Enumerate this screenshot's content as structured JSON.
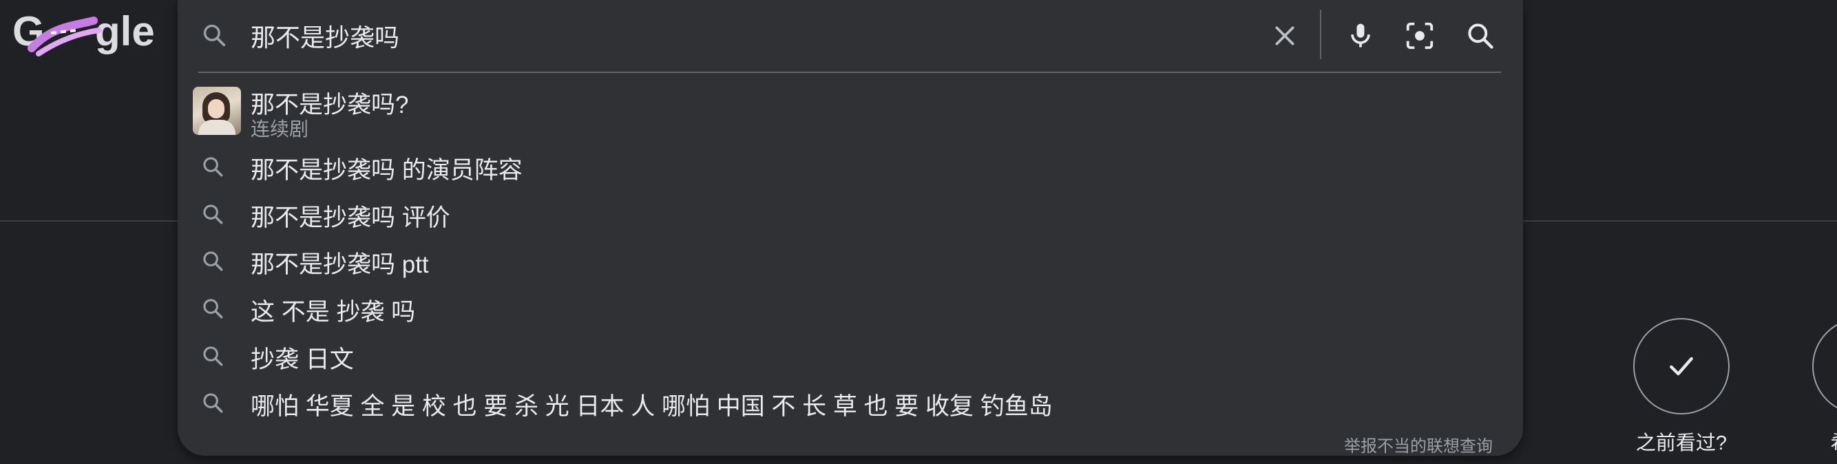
{
  "logo": {
    "label": "Google"
  },
  "search": {
    "query": "那不是抄袭吗",
    "report_link": "举报不当的联想查询"
  },
  "suggestions": {
    "first": {
      "title": "那不是抄袭吗?",
      "subtitle": "连续剧"
    },
    "items": [
      {
        "text": "那不是抄袭吗 的演员阵容"
      },
      {
        "text": "那不是抄袭吗 评价"
      },
      {
        "text": "那不是抄袭吗 ptt"
      },
      {
        "text": "这 不是 抄袭 吗"
      },
      {
        "text": "抄袭 日文"
      },
      {
        "text": "哪怕 华夏 全 是 校 也 要 杀 光 日本 人 哪怕 中国 不 长 草 也 要 收复 钓鱼岛"
      }
    ]
  },
  "actions": {
    "watched_label": "之前看过?",
    "want_label": "希望观"
  },
  "colors": {
    "background": "#202124",
    "panel": "#303134",
    "text": "#e8eaed",
    "muted": "#9aa0a6",
    "doodle_accent": "#c77be4"
  },
  "icons": [
    "search-icon",
    "close-icon",
    "microphone-icon",
    "camera-lens-icon",
    "checkmark-icon",
    "bookmark-icon"
  ]
}
